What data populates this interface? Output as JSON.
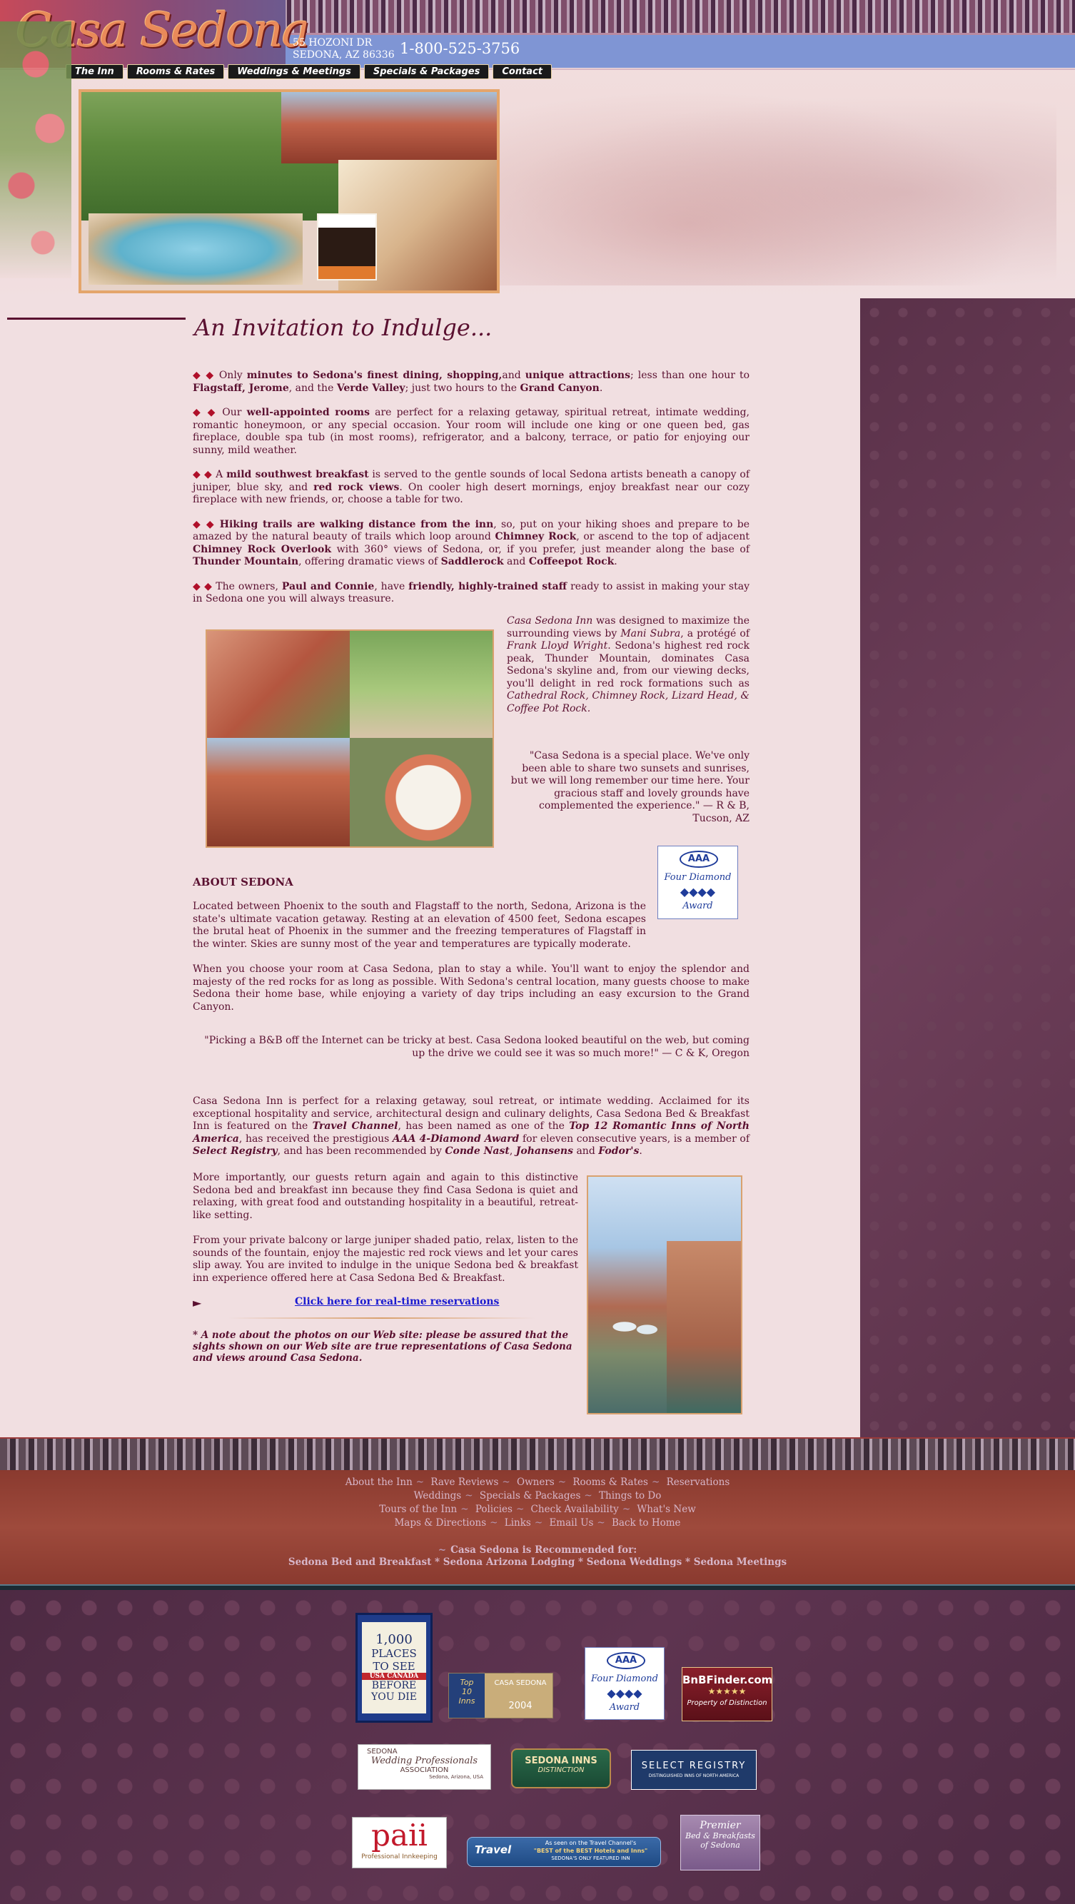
{
  "header": {
    "logo": "Casa Sedona",
    "address_line1": "55 HOZONI DR",
    "address_line2": "SEDONA, AZ 86336",
    "phone": "1-800-525-3756",
    "nav": [
      "The Inn",
      "Rooms & Rates",
      "Weddings & Meetings",
      "Specials & Packages",
      "Contact"
    ]
  },
  "main": {
    "heading": "An Invitation to Indulge...",
    "p1": {
      "a": "Only ",
      "b": "minutes to Sedona's finest dining, shopping,",
      "c": "and ",
      "d": "unique attractions",
      "e": "; less than one hour to ",
      "f": "Flagstaff, Jerome",
      "g": ", and the ",
      "h": "Verde Valley",
      "i": "; just two hours to the ",
      "j": "Grand Canyon",
      "k": "."
    },
    "p2": {
      "a": "Our ",
      "b": "well-appointed rooms",
      "c": " are perfect for a relaxing getaway, spiritual retreat, intimate wedding, romantic honeymoon, or any special occasion. Your room will include one king or one queen bed, gas fireplace, double spa tub (in most rooms), refrigerator, and a balcony, terrace, or patio for enjoying our sunny, mild weather."
    },
    "p3": {
      "a": "A ",
      "b": "mild southwest breakfast",
      "c": " is served to the gentle sounds of local Sedona artists beneath a canopy of juniper, blue sky, and ",
      "d": "red rock views",
      "e": ". On cooler high desert mornings, enjoy breakfast near our cozy fireplace with new friends, or, choose a table for two."
    },
    "p4": {
      "a": "Hiking trails are walking distance from the inn",
      "b": ", so, put on your hiking shoes and prepare to be amazed by the natural beauty of trails which loop around ",
      "c": "Chimney Rock",
      "d": ", or ascend to the top of adjacent ",
      "e": "Chimney Rock Overlook",
      "f": " with 360° views of Sedona, or, if you prefer, just meander along the base of ",
      "g": "Thunder Mountain",
      "h": ", offering dramatic views of ",
      "i": "Saddlerock",
      "j": " and ",
      "k": "Coffeepot Rock",
      "l": "."
    },
    "p5": {
      "a": "The owners, ",
      "b": "Paul and Connie",
      "c": ", have ",
      "d": "friendly, highly-trained staff",
      "e": " ready to assist in making your stay in Sedona one you will always treasure."
    },
    "design": {
      "a": "Casa Sedona Inn",
      "b": " was designed to maximize the surrounding views by ",
      "c": "Mani Subra",
      "d": ", a protégé of ",
      "e": "Frank Lloyd Wright",
      "f": ". Sedona's highest red rock peak, Thunder Mountain, dominates Casa Sedona's skyline and, from our viewing decks, you'll delight in red rock formations such as ",
      "g": "Cathedral Rock, Chimney Rock, Lizard Head, & Coffee Pot Rock."
    },
    "quote1": "\"Casa Sedona is a special place. We've only been able to share two sunsets and sunrises, but we will long remember our time here. Your gracious staff and lovely grounds have complemented the experience.\" — R & B, Tucson, AZ",
    "aaa_badge": {
      "top": "AAA",
      "line1": "Four Diamond",
      "line2": "Award"
    },
    "about_heading": "ABOUT SEDONA",
    "about_p1": "Located between Phoenix to the south and Flagstaff to the north, Sedona, Arizona is the state's ultimate vacation getaway. Resting at an elevation of 4500 feet, Sedona escapes the brutal heat of Phoenix in the summer and the freezing temperatures of Flagstaff in the winter. Skies are sunny most of the year and temperatures are typically moderate.",
    "about_p2": "When you choose your room at Casa Sedona, plan to stay a while. You'll want to enjoy the splendor and majesty of the red rocks for as long as possible. With Sedona's central location, many guests choose to make Sedona their home base, while enjoying a variety of day trips including an easy excursion to the Grand Canyon.",
    "quote2": "\"Picking a B&B off the Internet can be tricky at best. Casa Sedona looked beautiful on the web, but coming up the drive we could see it was so much more!\" — C & K, Oregon",
    "awards": {
      "a": "Casa Sedona Inn is perfect for a relaxing getaway, soul retreat, or intimate wedding. Acclaimed for its exceptional hospitality and service, architectural design and culinary delights, Casa Sedona Bed & Breakfast Inn is featured on the ",
      "b": "Travel Channel",
      "c": ", has been named as one of the ",
      "d": "Top 12 Romantic Inns of North America",
      "e": ", has received the prestigious ",
      "f": "AAA 4-Diamond Award",
      "g": " for eleven consecutive years, is a member of ",
      "h": "Select Registry",
      "i": ", and has been recommended by ",
      "j": "Conde Nast",
      "k": ", ",
      "l": "Johansens",
      "m": " and ",
      "n": "Fodor's",
      "o": "."
    },
    "more_p1": "More importantly, our guests return again and again to this distinctive Sedona bed and breakfast inn because they find Casa Sedona is quiet and relaxing, with great food and outstanding hospitality in a beautiful, retreat-like setting.",
    "more_p2": "From your private balcony or large juniper shaded patio, relax, listen to the sounds of the fountain, enjoy the majestic red rock views and let your cares slip away. You are invited to indulge in the unique Sedona bed & breakfast inn experience offered here at Casa Sedona Bed & Breakfast.",
    "reservations_link": "Click here for real-time reservations",
    "note": "* A note about the photos on our Web site: please be assured that the sights shown on our Web site are true representations of Casa Sedona and views around Casa Sedona."
  },
  "footer": {
    "links_row1": [
      "About the Inn",
      "Rave Reviews",
      "Owners",
      "Rooms & Rates",
      "Reservations"
    ],
    "links_row2": [
      "Weddings",
      "Specials & Packages",
      "Things to Do"
    ],
    "links_row3": [
      "Tours of the Inn",
      "Policies",
      "Check Availability",
      "What's New"
    ],
    "links_row4": [
      "Maps & Directions",
      "Links",
      "Email Us",
      "Back to Home"
    ],
    "recommended_label": "Casa Sedona is Recommended for:",
    "recommended_items": "Sedona Bed and Breakfast * Sedona Arizona Lodging * Sedona Weddings * Sedona Meetings"
  },
  "badges": {
    "book": {
      "l1": "1,000",
      "l2": "PLACES",
      "l3": "TO SEE",
      "l4": "BEFORE",
      "l5": "YOU DIE",
      "banner": "USA CANADA"
    },
    "top10": {
      "l1": "Top",
      "l2": "10",
      "l3": "Inns",
      "casa": "CASA SEDONA",
      "year": "2004"
    },
    "aaa": {
      "top": "AAA",
      "l1": "Four Diamond",
      "l2": "Award"
    },
    "bnb": {
      "l1": "BnBFinder.com",
      "stars": "★★★★★",
      "l2": "Property of Distinction"
    },
    "wedding": {
      "l1": "SEDONA",
      "l2": "Wedding Professionals",
      "l3": "ASSOCIATION",
      "l4": "Sedona, Arizona, USA"
    },
    "inns": {
      "l1": "SEDONA INNS",
      "l2": "DISTINCTION"
    },
    "select": {
      "l1": "SELECT REGISTRY",
      "l2": "DISTINGUISHED INNS OF NORTH AMERICA"
    },
    "paii": {
      "l1": "paii",
      "l2": "Professional Innkeeping"
    },
    "travel": {
      "l1": "Travel",
      "l2": "As seen on the Travel Channel's",
      "l3": "\"BEST of the BEST Hotels and Inns\"",
      "l4": "SEDONA'S ONLY FEATURED INN"
    },
    "premier": {
      "l1": "Premier",
      "l2": "Bed & Breakfasts",
      "l3": "of Sedona"
    }
  }
}
